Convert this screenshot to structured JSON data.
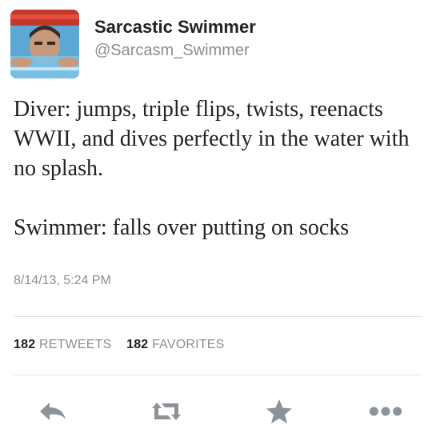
{
  "user": {
    "display_name": "Sarcastic Swimmer",
    "handle": "@Sarcasm_Swimmer"
  },
  "tweet": {
    "paragraph_1": "Diver: jumps, triple flips, twists, reenacts WWII, and dives perfectly in the water with no splash.",
    "paragraph_2": "Swimmer: falls over putting on socks",
    "timestamp": "8/14/13, 5:24 PM"
  },
  "stats": {
    "retweets_count": "182",
    "retweets_label": "RETWEETS",
    "favorites_count": "182",
    "favorites_label": "FAVORITES"
  },
  "actions": {
    "reply_icon": "reply-arrow-icon",
    "retweet_icon": "retweet-icon",
    "favorite_icon": "star-icon",
    "more_icon": "more-dots-icon"
  },
  "colors": {
    "text": "#222222",
    "muted": "#8a8f94",
    "icon": "#8b9298",
    "divider": "#e3e5e8"
  }
}
